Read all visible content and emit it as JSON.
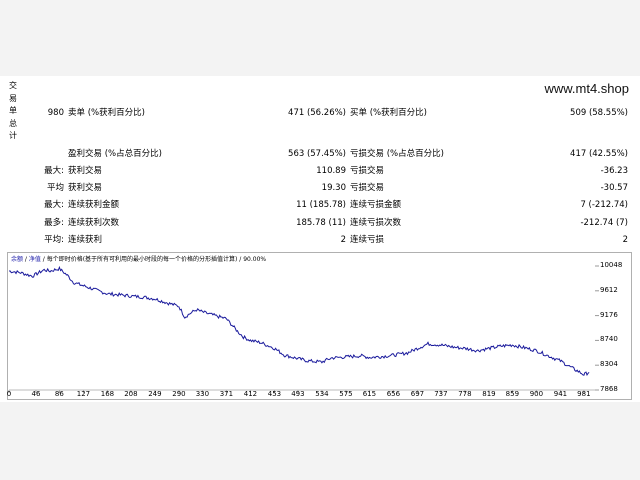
{
  "side_label": [
    "交",
    "易",
    "单",
    "总",
    "计"
  ],
  "site_text": "www.mt4.shop",
  "summary": {
    "total_trades": "980",
    "sell_label": "卖单 (%获利百分比)",
    "sell_value": "471 (56.26%)",
    "buy_label": "买单 (%获利百分比)",
    "buy_value": "509 (58.55%)"
  },
  "rows": {
    "profit_trades_label": "盈利交易 (%占总百分比)",
    "profit_trades_value": "563 (57.45%)",
    "loss_trades_label": "亏损交易 (%占总百分比)",
    "loss_trades_value": "417 (42.55%)",
    "max_prefix": "最大:",
    "max_profit_label": "获利交易",
    "max_profit_value": "110.89",
    "max_loss_label": "亏损交易",
    "max_loss_value": "-36.23",
    "avg_prefix": "平均",
    "avg_profit_label": "获利交易",
    "avg_profit_value": "19.30",
    "avg_loss_label": "亏损交易",
    "avg_loss_value": "-30.57",
    "max2_prefix": "最大:",
    "consec_win_amount_label": "连续获利金额",
    "consec_win_amount_value": "11 (185.78)",
    "consec_loss_amount_label": "连续亏损金额",
    "consec_loss_amount_value": "7 (-212.74)",
    "most_prefix": "最多:",
    "consec_win_count_label": "连续获利次数",
    "consec_win_count_value": "185.78 (11)",
    "consec_loss_count_label": "连续亏损次数",
    "consec_loss_count_value": "-212.74 (7)",
    "avg2_prefix": "平均:",
    "consec_win_label": "连续获利",
    "consec_win_value": "2",
    "consec_loss_label": "连续亏损",
    "consec_loss_value": "2"
  },
  "chart_header": {
    "part1": "余额",
    "sep1": " / ",
    "part2": "净值",
    "rest": " / 每个即时价格(基于所有可利用的最小时段的每一个价格的分形插值计算) / 90.00%"
  },
  "chart_data": {
    "type": "line",
    "x_ticks": [
      "0",
      "46",
      "86",
      "127",
      "168",
      "208",
      "249",
      "290",
      "330",
      "371",
      "412",
      "453",
      "493",
      "534",
      "575",
      "615",
      "656",
      "697",
      "737",
      "778",
      "819",
      "859",
      "900",
      "941",
      "981"
    ],
    "y_ticks": [
      "10048",
      "9612",
      "9176",
      "8740",
      "8304",
      "7868"
    ],
    "ylim": [
      7868,
      10048
    ],
    "xlim": [
      0,
      1000
    ],
    "series": [
      {
        "color": "#1a1a9c",
        "x": [
          0,
          20,
          40,
          60,
          70,
          86,
          100,
          110,
          127,
          150,
          168,
          190,
          208,
          230,
          249,
          270,
          290,
          300,
          310,
          320,
          330,
          350,
          371,
          390,
          400,
          412,
          430,
          453,
          470,
          493,
          510,
          534,
          550,
          575,
          600,
          615,
          640,
          656,
          680,
          697,
          715,
          737,
          760,
          778,
          800,
          819,
          840,
          859,
          880,
          900,
          920,
          941,
          960,
          981,
          990
        ],
        "y": [
          9960,
          9930,
          9870,
          9980,
          9960,
          10000,
          9880,
          9760,
          9700,
          9620,
          9560,
          9540,
          9520,
          9500,
          9470,
          9400,
          9340,
          9150,
          9220,
          9280,
          9240,
          9180,
          9120,
          8900,
          8800,
          8740,
          8700,
          8600,
          8480,
          8420,
          8380,
          8360,
          8430,
          8450,
          8470,
          8440,
          8460,
          8480,
          8520,
          8600,
          8680,
          8660,
          8620,
          8600,
          8560,
          8600,
          8640,
          8660,
          8610,
          8560,
          8470,
          8380,
          8260,
          8140,
          8180
        ]
      }
    ]
  }
}
